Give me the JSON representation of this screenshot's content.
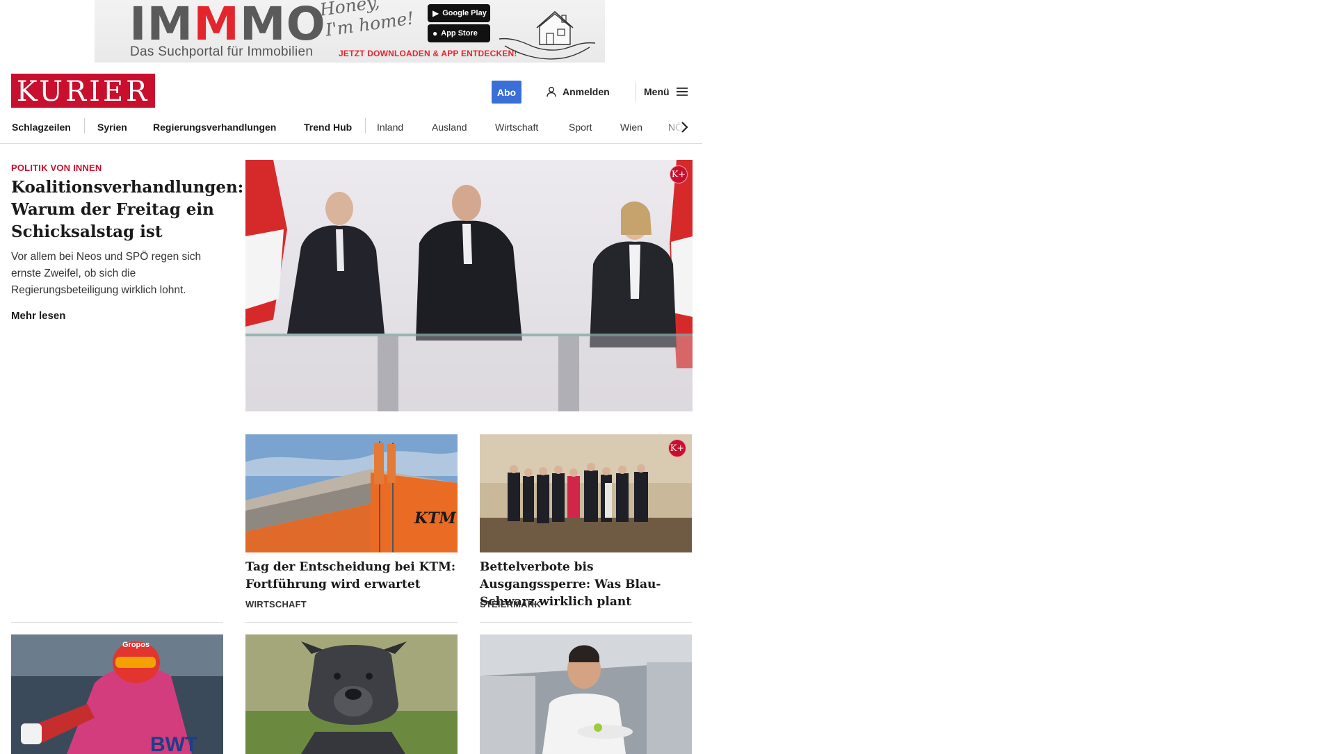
{
  "ad": {
    "brand_pre": "IM",
    "brand_accent": "M",
    "brand_post": "MO",
    "tagline": "Das Suchportal für Immobilien",
    "script_line1": "Honey,",
    "script_line2": "I'm home!",
    "store_google": "Google Play",
    "store_apple": "App Store",
    "cta": "JETZT DOWNLOADEN & APP ENTDECKEN!"
  },
  "header": {
    "logo": "KURIER",
    "abo_label": "Abo",
    "login_label": "Anmelden",
    "menu_label": "Menü"
  },
  "nav": {
    "items": [
      "Schlagzeilen",
      "Syrien",
      "Regierungsverhandlungen",
      "Trend Hub",
      "Inland",
      "Ausland",
      "Wirtschaft",
      "Sport",
      "Wien",
      "NÖ"
    ]
  },
  "lead": {
    "kicker": "POLITIK VON INNEN",
    "title": "Koalitionsverhandlungen: Warum der Freitag ein Schicksalstag ist",
    "teaser": "Vor allem bei Neos und SPÖ regen sich ernste Zweifel, ob sich die Regierungsbeteiligung wirklich lohnt.",
    "more": "Mehr lesen",
    "premium_badge": "K+"
  },
  "teasers": [
    {
      "title": "Tag der Entscheidung bei KTM: Fortführung wird erwartet",
      "section": "WIRTSCHAFT"
    },
    {
      "title": "Bettelverbote bis Ausgangssperre: Was Blau-Schwarz wirklich plant",
      "section": "STEIERMARK",
      "premium_badge": "K+"
    }
  ],
  "photo_text": {
    "ktm_sign": "KTM",
    "ski_helmet": "Gropos",
    "ski_bib": "BWT"
  },
  "colors": {
    "brand_red": "#c8102e",
    "abo_blue": "#3a6fd8"
  }
}
